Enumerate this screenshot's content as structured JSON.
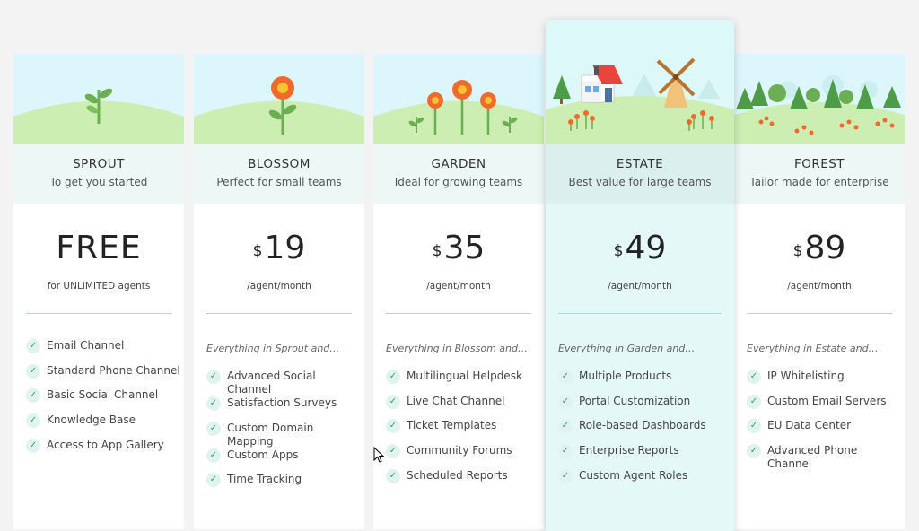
{
  "plans": [
    {
      "name": "SPROUT",
      "tagline": "To get you started",
      "price": "FREE",
      "currency": "",
      "unit": "for UNLIMITED agents",
      "intro": "",
      "features": [
        "Email Channel",
        "Standard Phone Channel",
        "Basic Social Channel",
        "Knowledge Base",
        "Access to App Gallery"
      ]
    },
    {
      "name": "BLOSSOM",
      "tagline": "Perfect for small teams",
      "price": "19",
      "currency": "$",
      "unit": "/agent/month",
      "intro": "Everything in Sprout and…",
      "features": [
        "Advanced Social Channel",
        "Satisfaction Surveys",
        "Custom Domain Mapping",
        "Custom Apps",
        "Time Tracking"
      ]
    },
    {
      "name": "GARDEN",
      "tagline": "Ideal for growing teams",
      "price": "35",
      "currency": "$",
      "unit": "/agent/month",
      "intro": "Everything in Blossom and…",
      "features": [
        "Multilingual Helpdesk",
        "Live Chat Channel",
        "Ticket Templates",
        "Community Forums",
        "Scheduled Reports"
      ]
    },
    {
      "name": "ESTATE",
      "tagline": "Best value for large teams",
      "price": "49",
      "currency": "$",
      "unit": "/agent/month",
      "intro": "Everything in Garden and…",
      "features": [
        "Multiple Products",
        "Portal Customization",
        "Role-based Dashboards",
        "Enterprise Reports",
        "Custom Agent Roles"
      ]
    },
    {
      "name": "FOREST",
      "tagline": "Tailor made for enterprise",
      "price": "89",
      "currency": "$",
      "unit": "/agent/month",
      "intro": "Everything in Estate and…",
      "features": [
        "IP Whitelisting",
        "Custom Email Servers",
        "EU Data Center",
        "Advanced Phone Channel"
      ]
    }
  ],
  "icons": {
    "check": "check-icon",
    "cursor": "mouse-cursor-icon"
  },
  "colors": {
    "accent": "#2e9e84",
    "featured_bg": "#e3f8f7",
    "sky": "#dcf6fb",
    "grass": "#cdeeb2",
    "flower": "#f06a2c"
  }
}
